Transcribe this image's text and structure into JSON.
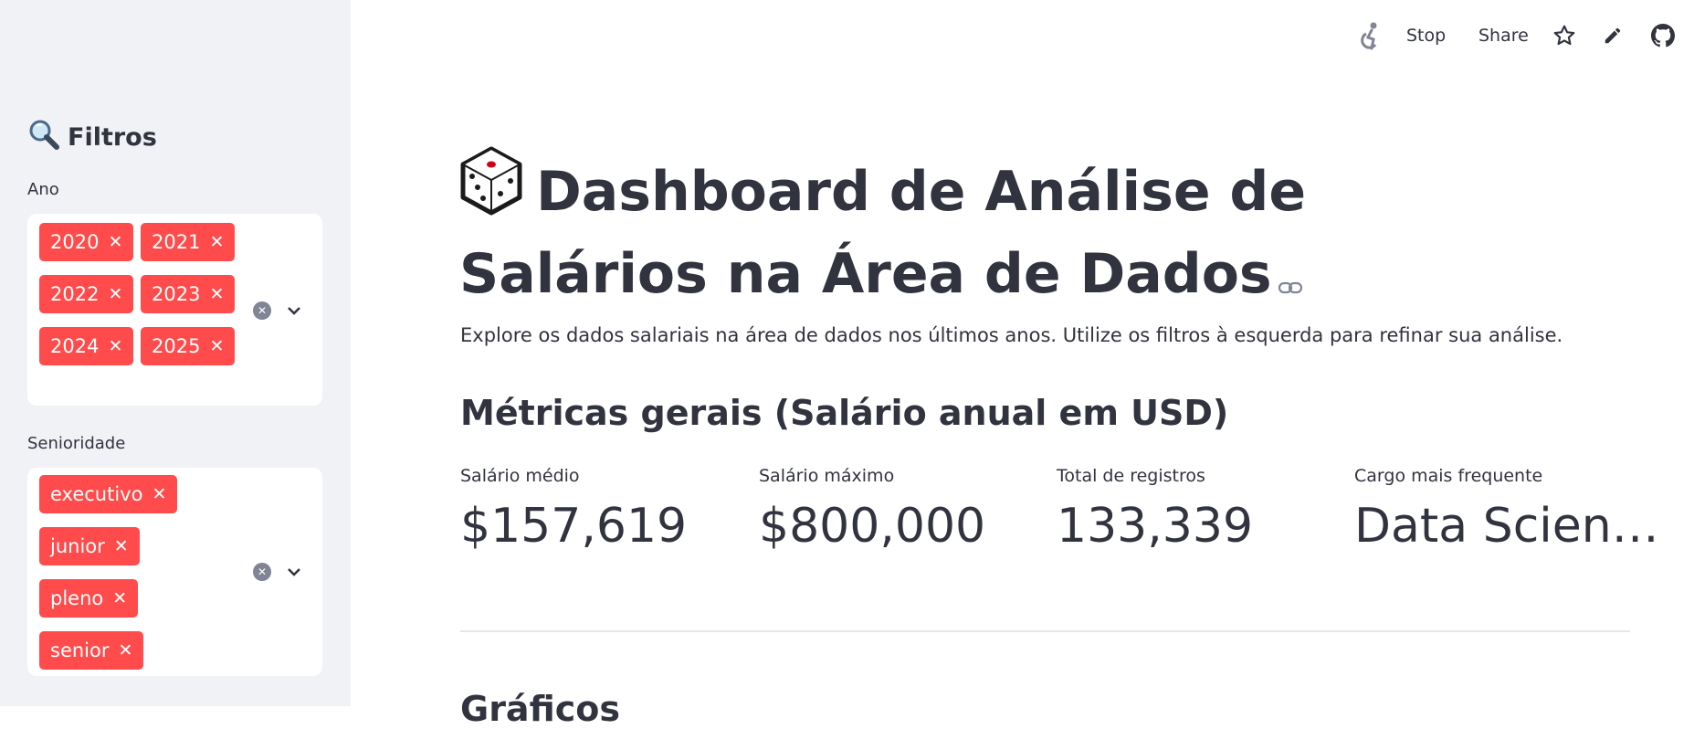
{
  "toolbar": {
    "stop_label": "Stop",
    "share_label": "Share"
  },
  "sidebar": {
    "title": "Filtros",
    "filters": [
      {
        "label": "Ano",
        "tags": [
          "2020",
          "2021",
          "2022",
          "2023",
          "2024",
          "2025"
        ]
      },
      {
        "label": "Senioridade",
        "tags": [
          "executivo",
          "junior",
          "pleno",
          "senior"
        ]
      }
    ]
  },
  "main": {
    "title": "Dashboard de Análise de Salários na Área de Dados",
    "intro": "Explore os dados salariais na área de dados nos últimos anos. Utilize os filtros à esquerda para refinar sua análise.",
    "metrics_heading": "Métricas gerais (Salário anual em USD)",
    "metrics": [
      {
        "label": "Salário médio",
        "value": "$157,619"
      },
      {
        "label": "Salário máximo",
        "value": "$800,000"
      },
      {
        "label": "Total de registros",
        "value": "133,339"
      },
      {
        "label": "Cargo mais frequente",
        "value": "Data Scien…"
      }
    ],
    "next_heading": "Gráficos"
  },
  "colors": {
    "accent": "#ff4b4b",
    "text": "#31333f",
    "sidebar_bg": "#f0f2f6"
  }
}
